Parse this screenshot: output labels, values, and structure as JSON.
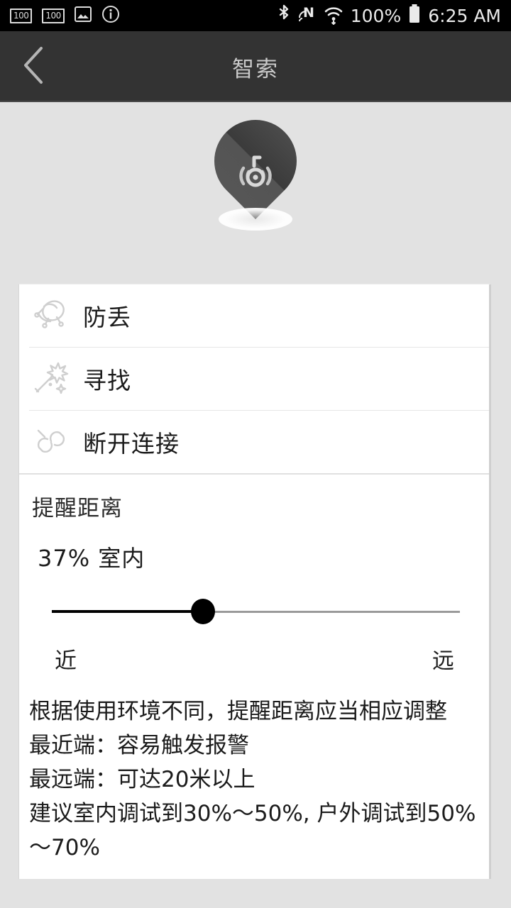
{
  "statusbar": {
    "left_icons": [
      {
        "name": "battery-100-badge-1",
        "label": "100"
      },
      {
        "name": "battery-100-badge-2",
        "label": "100"
      },
      {
        "name": "image-icon",
        "label": ""
      },
      {
        "name": "info-icon",
        "label": ""
      }
    ],
    "bluetooth_icon": "bluetooth-icon",
    "nfc_icon": "nfc-icon",
    "wifi_icon": "wifi-icon",
    "battery_percent": "100%",
    "battery_icon": "battery-full-icon",
    "time": "6:25 AM"
  },
  "appbar": {
    "back_icon": "back-chevron-icon",
    "title": "智索"
  },
  "hero": {
    "pin_icon": "map-pin-device-icon"
  },
  "actions": [
    {
      "id": "anti-lost",
      "label": "防丢",
      "icon": "parachute-anti-lost-icon"
    },
    {
      "id": "find",
      "label": "寻找",
      "icon": "magic-wand-find-icon"
    },
    {
      "id": "disconnect",
      "label": "断开连接",
      "icon": "broken-link-disconnect-icon"
    }
  ],
  "distance": {
    "title": "提醒距离",
    "value_text": "37% 室内",
    "percent": 37,
    "near_label": "近",
    "far_label": "远"
  },
  "description": {
    "lines": [
      "根据使用环境不同，提醒距离应当相应调整",
      "最近端：容易触发报警",
      "最远端：可达20米以上",
      "建议室内调试到30%～50%, 户外调试到50%～70%"
    ]
  },
  "colors": {
    "page_bg": "#e2e2e2",
    "appbar_bg": "#333333",
    "card_bg": "#ffffff",
    "accent": "#000000"
  }
}
